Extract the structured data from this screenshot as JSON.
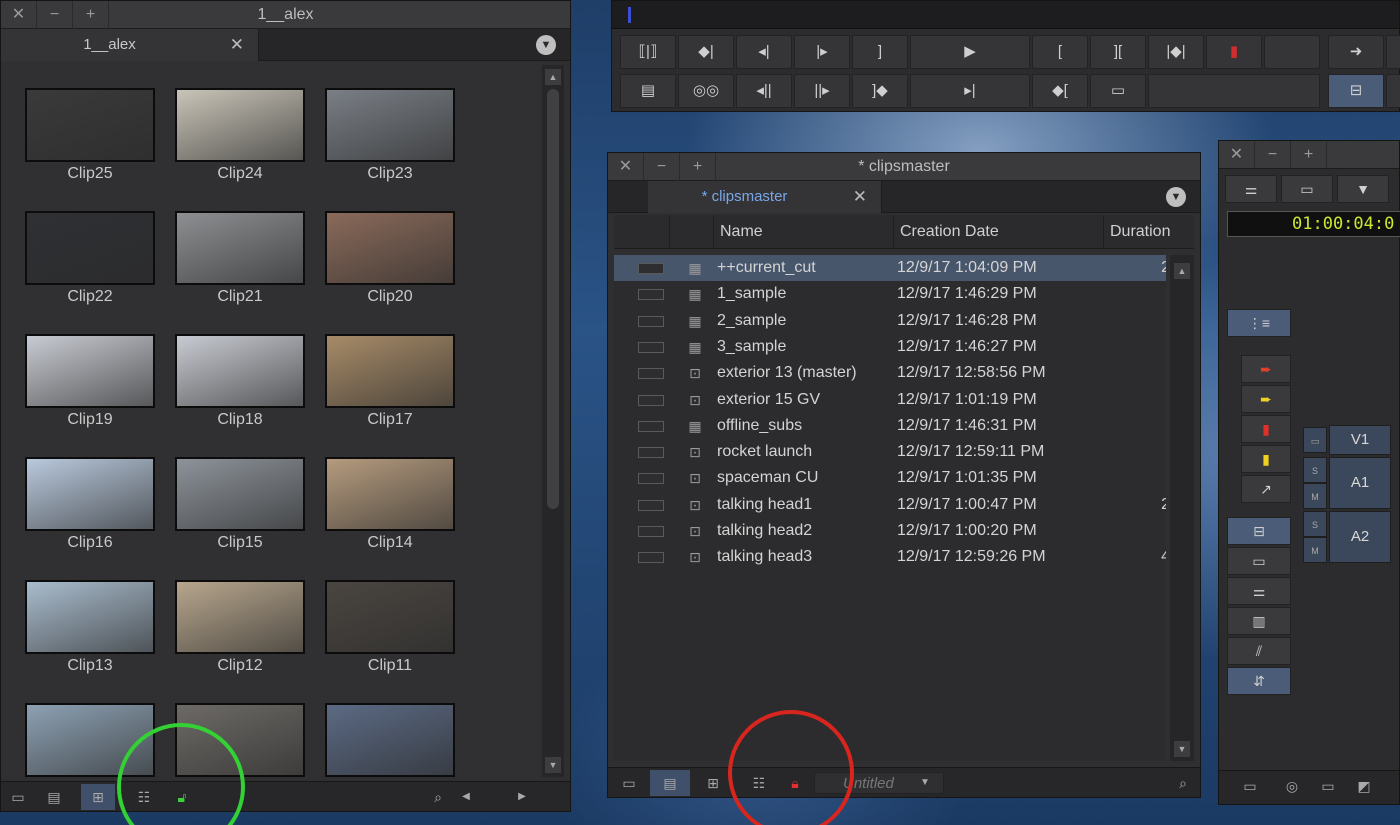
{
  "left_bin": {
    "window_title": "1__alex",
    "tab_label": "1__alex",
    "clips": [
      {
        "name": "Clip25",
        "color": "#3a3a3a"
      },
      {
        "name": "Clip24",
        "color": "#c9c4b8"
      },
      {
        "name": "Clip23",
        "color": "#7a7f86"
      },
      {
        "name": "Clip22",
        "color": "#2e3034"
      },
      {
        "name": "Clip21",
        "color": "#8d8f92"
      },
      {
        "name": "Clip20",
        "color": "#8a6a5a"
      },
      {
        "name": "Clip19",
        "color": "#c8cbd2"
      },
      {
        "name": "Clip18",
        "color": "#c8cbd2"
      },
      {
        "name": "Clip17",
        "color": "#a78b68"
      },
      {
        "name": "Clip16",
        "color": "#b9c9dd"
      },
      {
        "name": "Clip15",
        "color": "#8d939a"
      },
      {
        "name": "Clip14",
        "color": "#b59b7e"
      },
      {
        "name": "Clip13",
        "color": "#a9bccd"
      },
      {
        "name": "Clip12",
        "color": "#b7a68d"
      },
      {
        "name": "Clip11",
        "color": "#4a4540"
      },
      {
        "name": "",
        "color": "#8da1b3"
      },
      {
        "name": "",
        "color": "#6d6a66"
      },
      {
        "name": "",
        "color": "#5b6a84"
      }
    ]
  },
  "clipsmaster": {
    "window_title": "* clipsmaster",
    "tab_label": "* clipsmaster",
    "columns": [
      "Name",
      "Creation Date",
      "Duration"
    ],
    "rows": [
      {
        "name": "++current_cut",
        "date": "12/9/17 1:04:09 PM",
        "dur": "2",
        "icon": "sequence-icon"
      },
      {
        "name": "1_sample",
        "date": "12/9/17 1:46:29 PM",
        "dur": "",
        "icon": "sequence-icon"
      },
      {
        "name": "2_sample",
        "date": "12/9/17 1:46:28 PM",
        "dur": "",
        "icon": "sequence-icon"
      },
      {
        "name": "3_sample",
        "date": "12/9/17 1:46:27 PM",
        "dur": "",
        "icon": "sequence-icon"
      },
      {
        "name": "exterior 13 (master)",
        "date": "12/9/17 12:58:56 PM",
        "dur": "",
        "icon": "masterclip-icon"
      },
      {
        "name": "exterior 15 GV",
        "date": "12/9/17 1:01:19 PM",
        "dur": "",
        "icon": "masterclip-icon"
      },
      {
        "name": "offline_subs",
        "date": "12/9/17 1:46:31 PM",
        "dur": "",
        "icon": "sequence-icon"
      },
      {
        "name": "rocket launch",
        "date": "12/9/17 12:59:11 PM",
        "dur": "",
        "icon": "masterclip-icon"
      },
      {
        "name": "spaceman CU",
        "date": "12/9/17 1:01:35 PM",
        "dur": "",
        "icon": "masterclip-icon"
      },
      {
        "name": "talking head1",
        "date": "12/9/17 1:00:47 PM",
        "dur": "2",
        "icon": "masterclip-icon"
      },
      {
        "name": "talking head2",
        "date": "12/9/17 1:00:20 PM",
        "dur": "",
        "icon": "masterclip-icon"
      },
      {
        "name": "talking head3",
        "date": "12/9/17 12:59:26 PM",
        "dur": "4",
        "icon": "masterclip-icon"
      }
    ],
    "bin_view_name": "Untitled"
  },
  "timeline": {
    "timecode": "01:00:04:0",
    "tracks": [
      "V1",
      "A1",
      "A2"
    ],
    "solo_label": "S",
    "mute_label": "M"
  },
  "colors": {
    "green_circle": "#33d133",
    "red_circle": "#d8261f",
    "selection": "#48566c"
  }
}
